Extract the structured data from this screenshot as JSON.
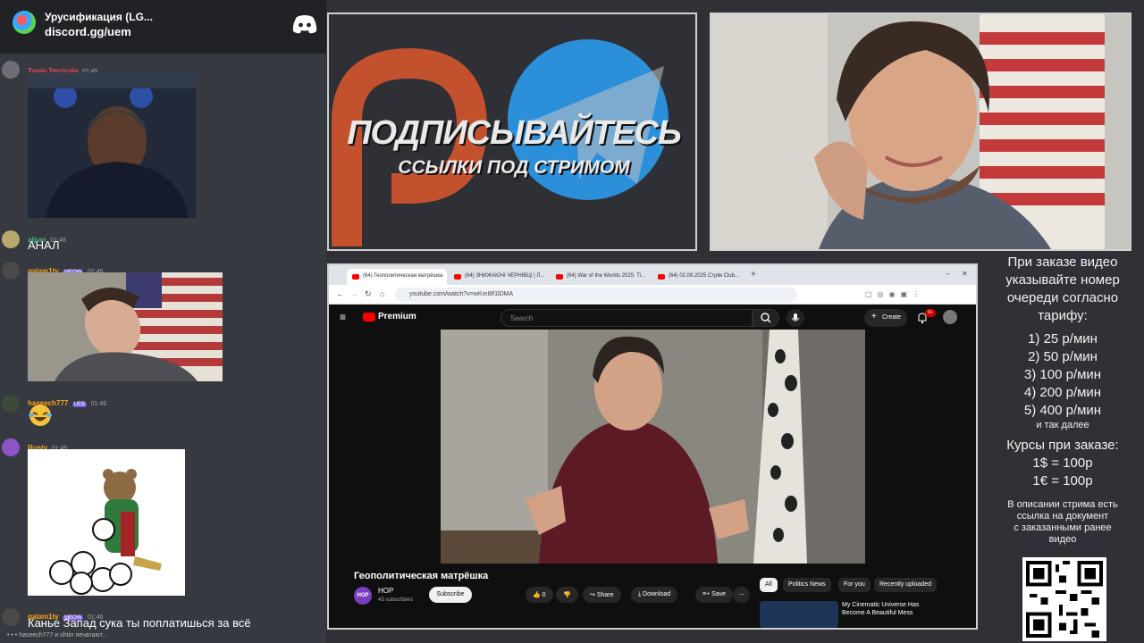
{
  "discord": {
    "server_name": "Урусификация (LG...",
    "invite": "discord.gg/uem",
    "messages": [
      {
        "name": "Tonio Terricola",
        "time": "01:45",
        "color": "#f04747"
      },
      {
        "name": "alpan",
        "time": "01:45",
        "text": "АНАЛ",
        "color": "#43b581"
      },
      {
        "name": "galam1ty",
        "badge": "MEOW",
        "time": "01:45",
        "color": "#faa61a"
      },
      {
        "name": "haseech777",
        "badge": "UEB",
        "time": "01:45",
        "color": "#faa61a"
      },
      {
        "name": "Rusty",
        "time": "01:45",
        "color": "#faa61a"
      },
      {
        "name": "galam1ty",
        "badge": "MEOW",
        "time": "01:46",
        "text": "Канье Запад сука ты поплатишься за всё",
        "color": "#faa61a"
      }
    ],
    "typing": "haseech777 и shtirr печатают..."
  },
  "promo": {
    "line1": "ПОДПИСЫВАЙТЕСЬ",
    "line2": "ССЫЛКИ ПОД СТРИМОМ"
  },
  "browser": {
    "tabs": [
      "(64) Геополитическая матрёшка",
      "(64) ЗНИЖАЮЧІ ЧЕРНІВЦІ | Л...",
      "(64) War of the Worlds 2025: Ti...",
      "(64) 02.09.2025 Стрім Club..."
    ],
    "url": "youtube.com/watch?v=wKmI8f1lDMA",
    "youtube": {
      "logo": "Premium",
      "search_placeholder": "Search",
      "create": "Create",
      "notifications": "9+",
      "video_title": "Геополитическая матрёшка",
      "channel_avatar": "HOP",
      "channel_name": "HOP",
      "subscribers": "43 subscribers",
      "subscribe": "Subscribe",
      "likes": "0",
      "share": "Share",
      "download": "Download",
      "save": "Save",
      "chips": [
        "All",
        "Politics News",
        "For you",
        "Recently uploaded"
      ],
      "rec_title": "My Cinematic Universe Has Become A Beautiful Mess"
    }
  },
  "pricing": {
    "header": [
      "При заказе видео",
      "указывайте номер",
      "очереди согласно",
      "тарифу:"
    ],
    "tiers": [
      "1) 25 р/мин",
      "2) 50 р/мин",
      "3) 100 р/мин",
      "4) 200 р/мин",
      "5) 400 р/мин"
    ],
    "etc": "и так далее",
    "rates_title": "Курсы при заказе:",
    "rates": [
      "1$ = 100р",
      "1€ = 100р"
    ],
    "footer": [
      "В описании стрима есть",
      "ссылка на документ",
      "с заказанными ранее",
      "видео"
    ]
  }
}
